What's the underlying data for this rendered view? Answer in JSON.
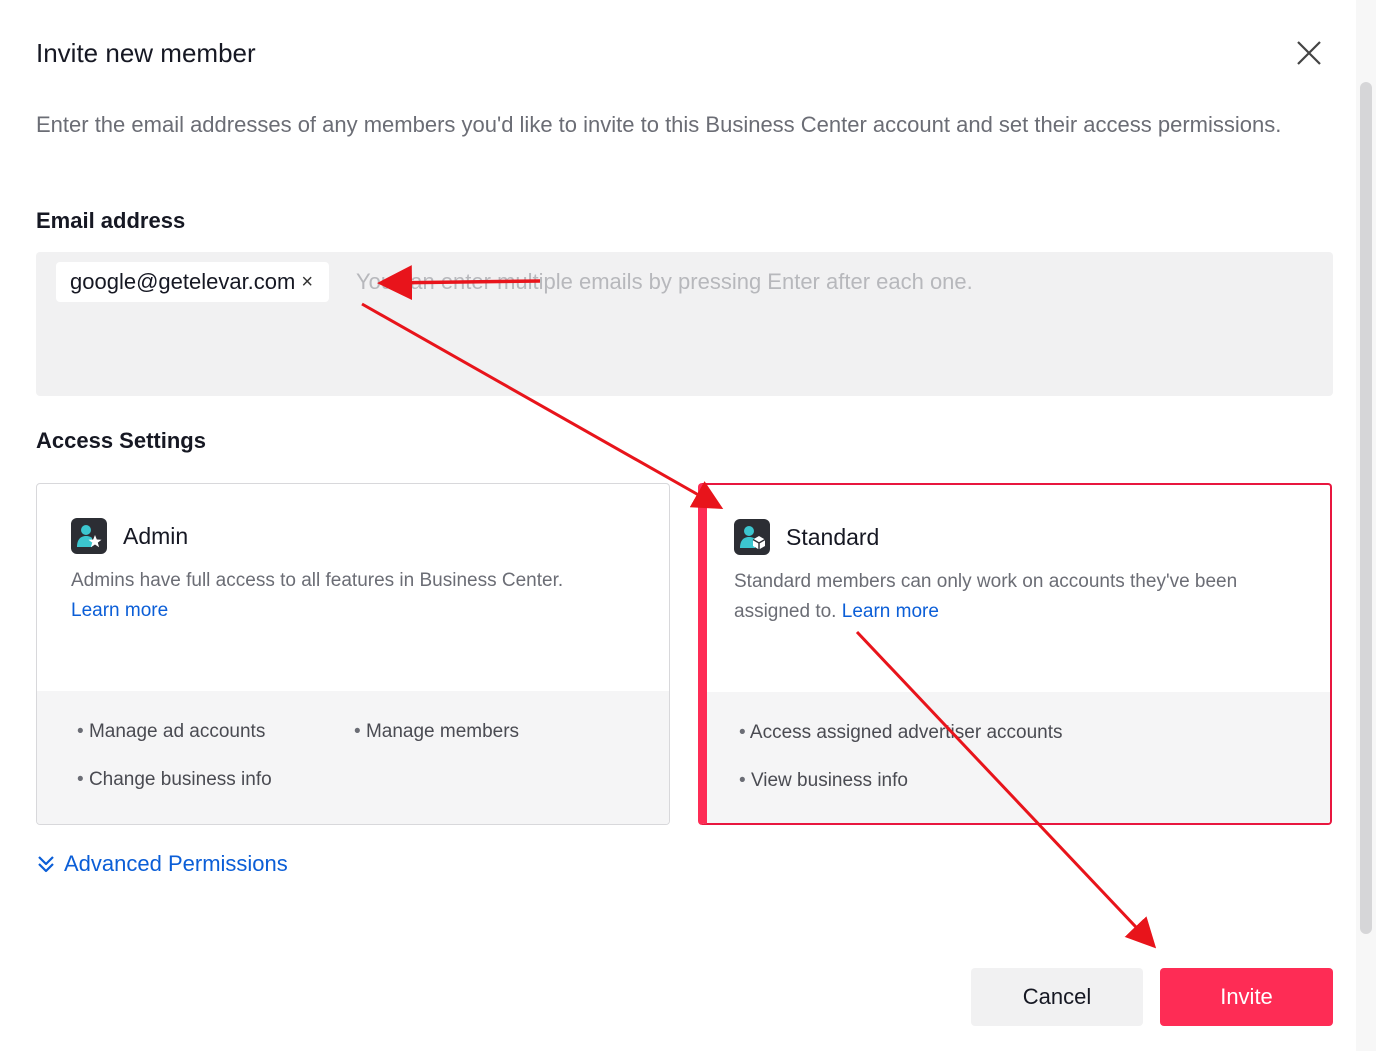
{
  "dialog": {
    "title": "Invite new member",
    "description": "Enter the email addresses of any members you'd like to invite to this Business Center account and set their access permissions."
  },
  "email": {
    "label": "Email address",
    "chip": "google@getelevar.com",
    "chip_remove": "×",
    "placeholder": "You can enter multiple emails by pressing Enter after each one."
  },
  "access": {
    "label": "Access Settings",
    "admin": {
      "name": "Admin",
      "description": "Admins have full access to all features in Business Center.",
      "learn_more": "Learn more",
      "permissions": [
        "Manage ad accounts",
        "Manage members",
        "Change business info"
      ],
      "icon": "user-star-icon"
    },
    "standard": {
      "name": "Standard",
      "description": "Standard members can only work on accounts they've been assigned to.",
      "learn_more": "Learn more",
      "permissions": [
        "Access assigned advertiser accounts",
        "View business info"
      ],
      "icon": "user-cube-icon",
      "selected": true
    }
  },
  "advanced": {
    "label": "Advanced Permissions",
    "icon": "double-chevron-down-icon"
  },
  "buttons": {
    "cancel": "Cancel",
    "invite": "Invite"
  },
  "colors": {
    "accent": "#fe2c55",
    "link": "#0b5ed7",
    "annotation": "#e8141b"
  }
}
